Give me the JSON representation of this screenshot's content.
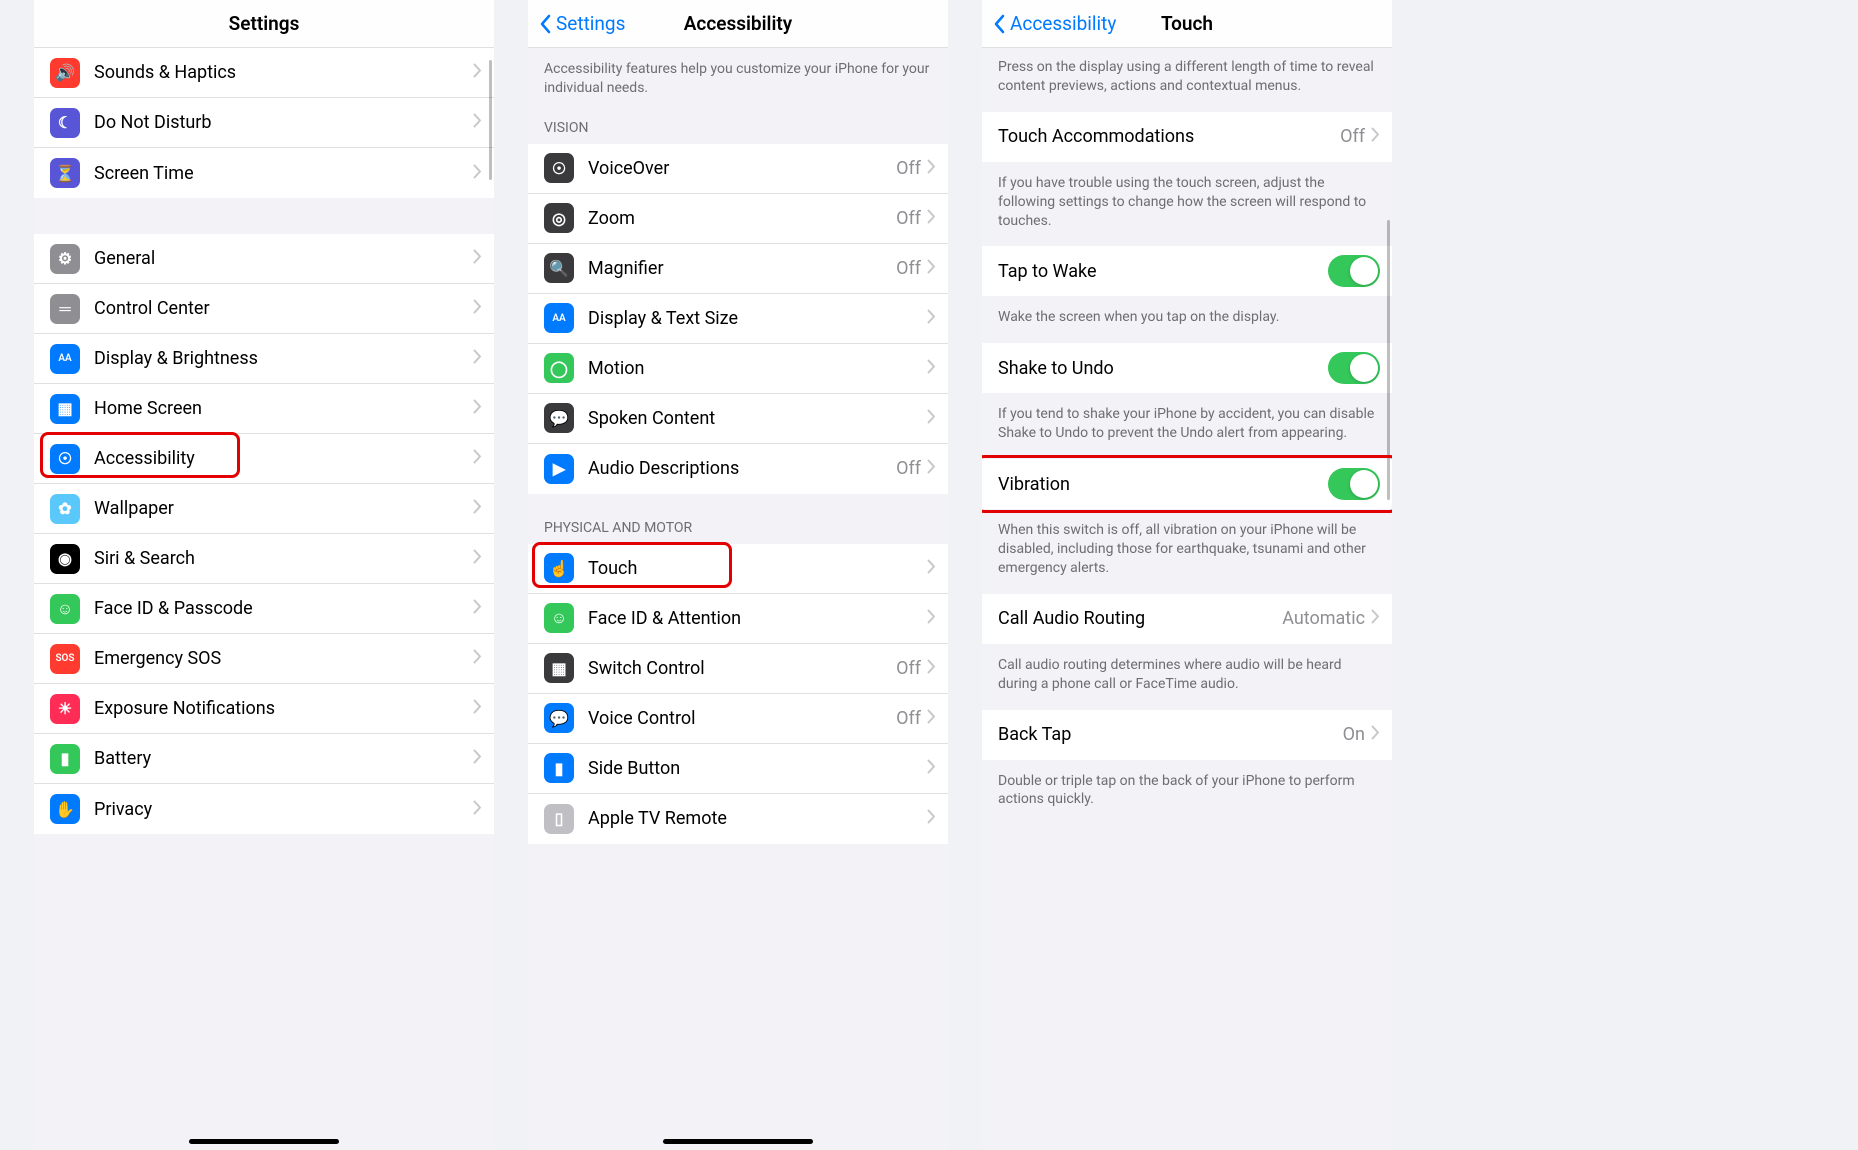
{
  "pane1": {
    "title": "Settings",
    "rows": [
      {
        "label": "Sounds & Haptics",
        "icon": "sounds-icon",
        "color": "ic-red"
      },
      {
        "label": "Do Not Disturb",
        "icon": "moon-icon",
        "color": "ic-purple"
      },
      {
        "label": "Screen Time",
        "icon": "hourglass-icon",
        "color": "ic-indigo"
      }
    ],
    "rows2": [
      {
        "label": "General",
        "icon": "gear-icon",
        "color": "ic-gray"
      },
      {
        "label": "Control Center",
        "icon": "switches-icon",
        "color": "ic-gray"
      },
      {
        "label": "Display & Brightness",
        "icon": "textsize-icon",
        "color": "ic-blue"
      },
      {
        "label": "Home Screen",
        "icon": "grid-icon",
        "color": "ic-blue"
      },
      {
        "label": "Accessibility",
        "icon": "accessibility-icon",
        "color": "ic-blue",
        "highlight": true
      },
      {
        "label": "Wallpaper",
        "icon": "flower-icon",
        "color": "ic-lblue"
      },
      {
        "label": "Siri & Search",
        "icon": "siri-icon",
        "color": "ic-black"
      },
      {
        "label": "Face ID & Passcode",
        "icon": "faceid-icon",
        "color": "ic-green"
      },
      {
        "label": "Emergency SOS",
        "icon": "sos-icon",
        "color": "ic-orange"
      },
      {
        "label": "Exposure Notifications",
        "icon": "exposure-icon",
        "color": "ic-pink"
      },
      {
        "label": "Battery",
        "icon": "battery-icon",
        "color": "ic-green"
      },
      {
        "label": "Privacy",
        "icon": "hand-icon",
        "color": "ic-blue"
      }
    ]
  },
  "pane2": {
    "back": "Settings",
    "title": "Accessibility",
    "intro": "Accessibility features help you customize your iPhone for your individual needs.",
    "header_vision": "VISION",
    "vision_rows": [
      {
        "label": "VoiceOver",
        "value": "Off",
        "icon": "voiceover-icon",
        "color": "ic-darkgray"
      },
      {
        "label": "Zoom",
        "value": "Off",
        "icon": "zoom-icon",
        "color": "ic-darkgray"
      },
      {
        "label": "Magnifier",
        "value": "Off",
        "icon": "magnifier-icon",
        "color": "ic-darkgray"
      },
      {
        "label": "Display & Text Size",
        "value": "",
        "icon": "textsize-icon",
        "color": "ic-blue"
      },
      {
        "label": "Motion",
        "value": "",
        "icon": "motion-icon",
        "color": "ic-green"
      },
      {
        "label": "Spoken Content",
        "value": "",
        "icon": "spoken-icon",
        "color": "ic-darkgray"
      },
      {
        "label": "Audio Descriptions",
        "value": "Off",
        "icon": "audiodesc-icon",
        "color": "ic-blue"
      }
    ],
    "header_motor": "PHYSICAL AND MOTOR",
    "motor_rows": [
      {
        "label": "Touch",
        "value": "",
        "icon": "touch-icon",
        "color": "ic-blue",
        "highlight": true
      },
      {
        "label": "Face ID & Attention",
        "value": "",
        "icon": "faceid-icon",
        "color": "ic-green"
      },
      {
        "label": "Switch Control",
        "value": "Off",
        "icon": "switch-icon",
        "color": "ic-darkgray"
      },
      {
        "label": "Voice Control",
        "value": "Off",
        "icon": "voicecontrol-icon",
        "color": "ic-blue"
      },
      {
        "label": "Side Button",
        "value": "",
        "icon": "sidebutton-icon",
        "color": "ic-blue"
      },
      {
        "label": "Apple TV Remote",
        "value": "",
        "icon": "remote-icon",
        "color": "ic-lightgray"
      }
    ]
  },
  "pane3": {
    "back": "Accessibility",
    "title": "Touch",
    "top_note": "Press on the display using a different length of time to reveal content previews, actions and contextual menus.",
    "rows": [
      {
        "label": "Touch Accommodations",
        "value": "Off",
        "chevron": true
      },
      {
        "note": "If you have trouble using the touch screen, adjust the following settings to change how the screen will respond to touches."
      },
      {
        "label": "Tap to Wake",
        "toggle": "on"
      },
      {
        "note": "Wake the screen when you tap on the display."
      },
      {
        "label": "Shake to Undo",
        "toggle": "on"
      },
      {
        "note": "If you tend to shake your iPhone by accident, you can disable Shake to Undo to prevent the Undo alert from appearing."
      },
      {
        "label": "Vibration",
        "toggle": "on",
        "highlight": true
      },
      {
        "note": "When this switch is off, all vibration on your iPhone will be disabled, including those for earthquake, tsunami and other emergency alerts."
      },
      {
        "label": "Call Audio Routing",
        "value": "Automatic",
        "chevron": true
      },
      {
        "note": "Call audio routing determines where audio will be heard during a phone call or FaceTime audio."
      },
      {
        "label": "Back Tap",
        "value": "On",
        "chevron": true
      },
      {
        "note": "Double or triple tap on the back of your iPhone to perform actions quickly."
      }
    ]
  }
}
